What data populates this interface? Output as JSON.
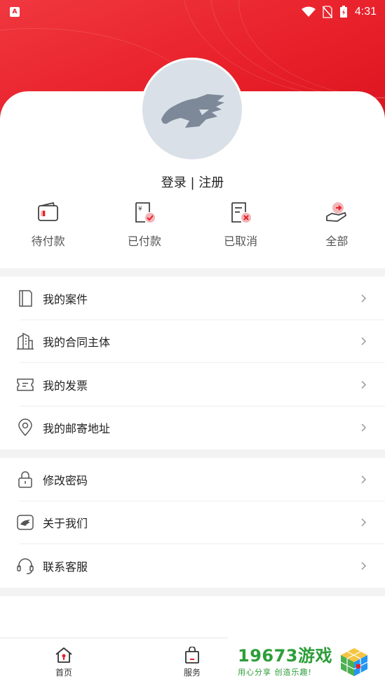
{
  "status_bar": {
    "time": "4:31",
    "app_badge": "A"
  },
  "profile": {
    "login_register": "登录 | 注册"
  },
  "orders": [
    {
      "label": "待付款",
      "icon": "wallet-icon"
    },
    {
      "label": "已付款",
      "icon": "paid-receipt-icon"
    },
    {
      "label": "已取消",
      "icon": "cancelled-receipt-icon"
    },
    {
      "label": "全部",
      "icon": "hand-money-icon"
    }
  ],
  "menu_group1": [
    {
      "label": "我的案件",
      "icon": "document-icon"
    },
    {
      "label": "我的合同主体",
      "icon": "building-icon"
    },
    {
      "label": "我的发票",
      "icon": "ticket-icon"
    },
    {
      "label": "我的邮寄地址",
      "icon": "location-pin-icon"
    }
  ],
  "menu_group2": [
    {
      "label": "修改密码",
      "icon": "lock-icon"
    },
    {
      "label": "关于我们",
      "icon": "horse-logo-icon"
    },
    {
      "label": "联系客服",
      "icon": "headset-icon"
    }
  ],
  "bottom_nav": {
    "home": "首页",
    "service": "服务"
  },
  "watermark": {
    "title": "19673游戏",
    "subtitle": "用心分享 创造乐趣!"
  },
  "colors": {
    "brand_red": "#e8202a",
    "watermark_green": "#2d9e3a"
  }
}
